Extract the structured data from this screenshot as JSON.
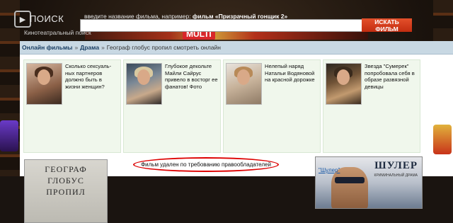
{
  "header": {
    "logo_title": "ПОИСК",
    "logo_subtitle": "Кинотеатральный поиск",
    "hint_prefix": "введите название фильма, например: ",
    "hint_example": "фильм «Призрачный гонщик 2»",
    "search_value": "",
    "search_button": "ИСКАТЬ ФИЛЬМ",
    "banner_badge": "MULTI"
  },
  "breadcrumb": {
    "home": "Онлайн фильмы",
    "sep": "»",
    "category": "Драма",
    "current": "Географ глобус пропил смотреть онлайн"
  },
  "teasers": [
    {
      "text": "Сколько сексуаль-ных партнеров должно быть в жизни женщин?"
    },
    {
      "text": "Глубокое декольте Майли Сайрус привело в восторг ее фанатов! Фото"
    },
    {
      "text": "Нелепый наряд Натальи Водяновой на красной дорожке"
    },
    {
      "text": "Звезда \"Сумерек\" попробовала себя в образе развязной девицы"
    }
  ],
  "poster": {
    "line1": "ГЕОГРАФ",
    "line2": "ГЛОБУС",
    "line3": "ПРОПИЛ"
  },
  "notice": "Фильм удален по требованию правообладателей",
  "ad": {
    "title": "ШУЛЕР",
    "subtitle": "КРИМИНАЛЬНЫЙ ДРАМА",
    "caption": "\"Шулер\""
  }
}
